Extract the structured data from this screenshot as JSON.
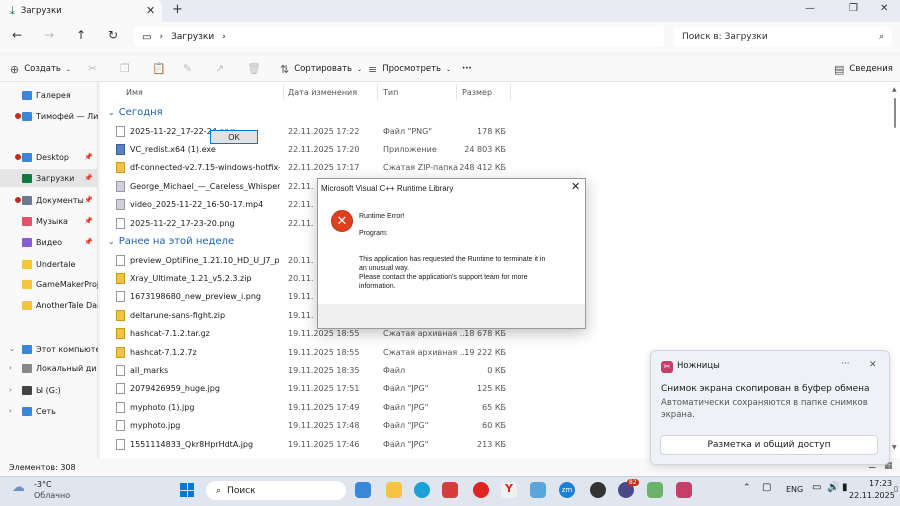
{
  "window": {
    "tab_title": "Загрузки",
    "breadcrumb": "Загрузки",
    "search_placeholder": "Поиск в: Загрузки"
  },
  "toolbar": {
    "create": "Создать",
    "sort": "Сортировать",
    "view": "Просмотреть",
    "more": "···",
    "details": "Сведения"
  },
  "columns": {
    "name": "Имя",
    "date": "Дата изменения",
    "type": "Тип",
    "size": "Размер"
  },
  "sidebar": [
    {
      "label": "Галерея",
      "color": "#3a86d8"
    },
    {
      "label": "Тимофей — Ли",
      "color": "#3a86d8"
    },
    {
      "label": "Desktop",
      "color": "#3a86d8"
    },
    {
      "label": "Загрузки",
      "color": "#0f7c3e"
    },
    {
      "label": "Документы",
      "color": "#6b7a90"
    },
    {
      "label": "Музыка",
      "color": "#e2526b"
    },
    {
      "label": "Видео",
      "color": "#8a5cd6"
    },
    {
      "label": "Undertale",
      "color": "#f5c542"
    },
    {
      "label": "GameMakerProj",
      "color": "#f5c542"
    },
    {
      "label": "AnotherTale Dar",
      "color": "#f5c542"
    },
    {
      "label": "Этот компьюте",
      "color": "#3a86d8"
    },
    {
      "label": "Локальный ди",
      "color": "#888888"
    },
    {
      "label": "Ы (G:)",
      "color": "#444444"
    },
    {
      "label": "Сеть",
      "color": "#3a86d8"
    }
  ],
  "groups": {
    "today": "Сегодня",
    "earlier": "Ранее на этой неделе"
  },
  "files_today": [
    {
      "name": "2025-11-22_17-22-24.png",
      "date": "22.11.2025 17:22",
      "type": "Файл \"PNG\"",
      "size": "178 КБ",
      "kind": "png"
    },
    {
      "name": "VC_redist.x64 (1).exe",
      "date": "22.11.2025 17:20",
      "type": "Приложение",
      "size": "24 803 КБ",
      "kind": "exe"
    },
    {
      "name": "df-connected-v2.7.15-windows-hotfix-b ...",
      "date": "22.11.2025 17:17",
      "type": "Сжатая ZIP-папка",
      "size": "248 412 КБ",
      "kind": "zip"
    },
    {
      "name": "George_Michael_—_Careless_Whisper_l'...",
      "date": "22.11.",
      "type": "",
      "size": "",
      "kind": "mp4"
    },
    {
      "name": "video_2025-11-22_16-50-17.mp4",
      "date": "22.11.",
      "type": "",
      "size": "",
      "kind": "mp4"
    },
    {
      "name": "2025-11-22_17-23-20.png",
      "date": "22.11.",
      "type": "",
      "size": "",
      "kind": "png"
    }
  ],
  "files_earlier": [
    {
      "name": "preview_OptiFine_1.21.10_HD_U_J7_pre2.jar",
      "date": "20.11.",
      "type": "",
      "size": "",
      "kind": "png"
    },
    {
      "name": "Xray_Ultimate_1.21_v5.2.3.zip",
      "date": "20.11.",
      "type": "",
      "size": "",
      "kind": "zip"
    },
    {
      "name": "1673198680_new_preview_i.png",
      "date": "19.11.",
      "type": "",
      "size": "",
      "kind": "png"
    },
    {
      "name": "deltarune-sans-fight.zip",
      "date": "19.11.",
      "type": "",
      "size": "",
      "kind": "zip"
    },
    {
      "name": "hashcat-7.1.2.tar.gz",
      "date": "19.11.2025 18:55",
      "type": "Сжатая архивная ...",
      "size": "18 678 КБ",
      "kind": "zip"
    },
    {
      "name": "hashcat-7.1.2.7z",
      "date": "19.11.2025 18:55",
      "type": "Сжатая архивная ...",
      "size": "19 222 КБ",
      "kind": "zip"
    },
    {
      "name": "all_marks",
      "date": "19.11.2025 18:35",
      "type": "Файл",
      "size": "0 КБ",
      "kind": "png"
    },
    {
      "name": "2079426959_huge.jpg",
      "date": "19.11.2025 17:51",
      "type": "Файл \"JPG\"",
      "size": "125 КБ",
      "kind": "png"
    },
    {
      "name": "myphoto (1).jpg",
      "date": "19.11.2025 17:49",
      "type": "Файл \"JPG\"",
      "size": "65 КБ",
      "kind": "png"
    },
    {
      "name": "myphoto.jpg",
      "date": "19.11.2025 17:48",
      "type": "Файл \"JPG\"",
      "size": "60 КБ",
      "kind": "png"
    },
    {
      "name": "1551114833_Qkr8HprHdtA.jpg",
      "date": "19.11.2025 17:46",
      "type": "Файл \"JPG\"",
      "size": "213 КБ",
      "kind": "png"
    }
  ],
  "status": {
    "items": "Элементов: 308"
  },
  "dialog": {
    "title": "Microsoft Visual C++ Runtime Library",
    "heading": "Runtime Error!",
    "program": "Program:",
    "line1": "This application has requested the Runtime to terminate it in",
    "line2": "an unusual way.",
    "line3": "Please contact the application's support team for more",
    "line4": "information.",
    "ok": "OK"
  },
  "toast": {
    "app": "Ножницы",
    "more": "···",
    "title": "Снимок экрана скопирован в буфер обмена",
    "body1": "Автоматически сохраняются в папке снимков",
    "body2": "экрана.",
    "button": "Разметка и общий доступ"
  },
  "taskbar": {
    "weather_temp": "-3°C",
    "weather_desc": "Облачно",
    "search": "Поиск",
    "lang": "ENG",
    "time": "17:23",
    "date": "22.11.2025",
    "badge": "82"
  }
}
